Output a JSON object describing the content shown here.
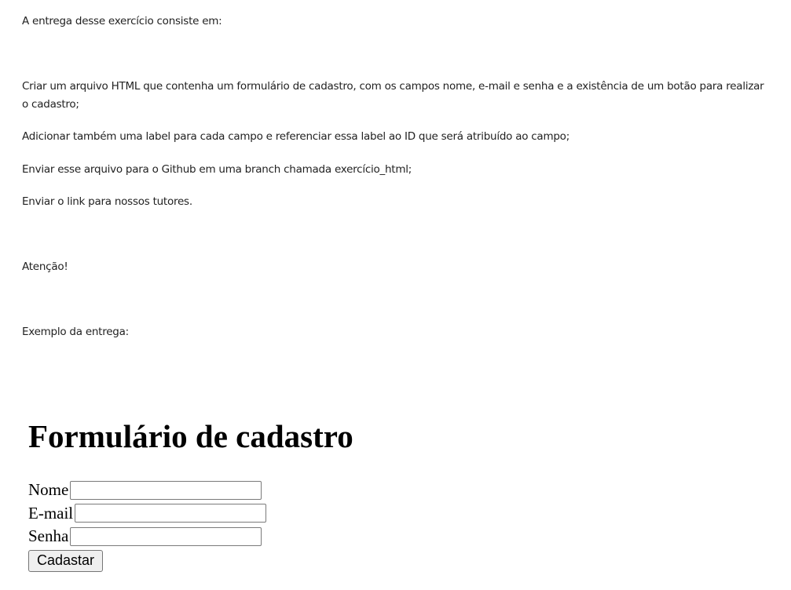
{
  "content": {
    "intro": "A entrega desse exercício consiste em:",
    "item1": "Criar um arquivo HTML que contenha um formulário de cadastro, com os campos nome, e-mail e senha e a existência de um botão para realizar o cadastro;",
    "item2": "Adicionar também uma label para cada campo e referenciar essa label ao ID que será atribuído ao campo;",
    "item3": "Enviar esse arquivo para o Github em uma branch chamada exercício_html;",
    "item4": "Enviar o link para nossos tutores.",
    "attention": "Atenção!",
    "example_label": "Exemplo da entrega:"
  },
  "example_form": {
    "title": "Formulário de cadastro",
    "fields": {
      "name_label": "Nome",
      "name_value": "",
      "email_label": "E-mail",
      "email_value": "",
      "password_label": "Senha",
      "password_value": ""
    },
    "submit_label": "Cadastar"
  }
}
